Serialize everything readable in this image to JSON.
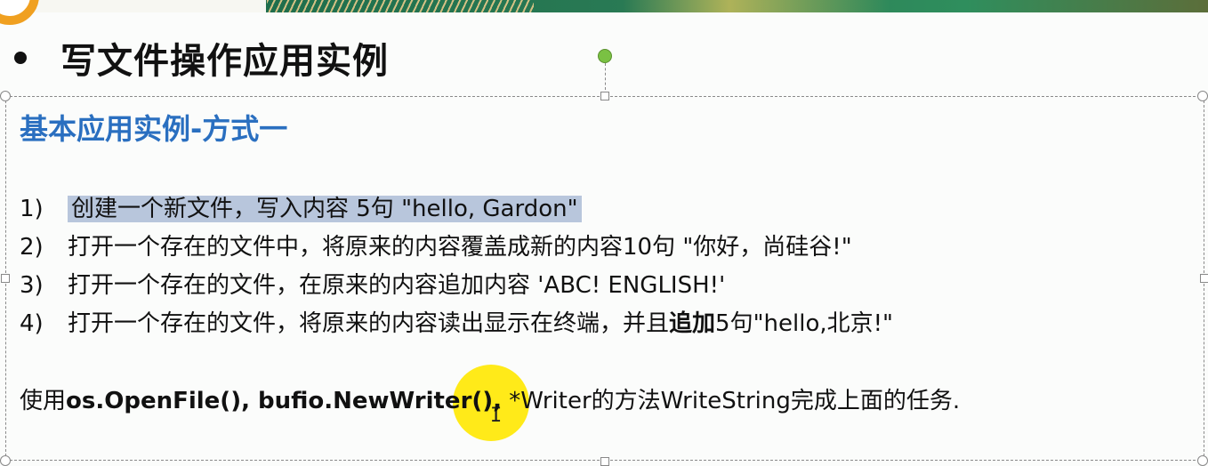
{
  "heading": "写文件操作应用实例",
  "subtitle": "基本应用实例-方式一",
  "tasks": [
    {
      "num": "1)",
      "text": "创建一个新文件，写入内容 5句 \"hello, Gardon\""
    },
    {
      "num": "2)",
      "text": "打开一个存在的文件中，将原来的内容覆盖成新的内容10句 \"你好，尚硅谷!\""
    },
    {
      "num": "3)",
      "text": "打开一个存在的文件，在原来的内容追加内容 'ABC! ENGLISH!'"
    },
    {
      "num": "4)",
      "text_before": "打开一个存在的文件，将原来的内容读出显示在终端，并且",
      "text_bold": "追加",
      "text_after": "5句\"hello,北京!\""
    }
  ],
  "footer": {
    "prefix": "使用",
    "bold_part": "os.OpenFile(), bufio.NewWriter(),",
    "suffix": " *Writer的方法WriteString完成上面的任务."
  },
  "colors": {
    "subtitle": "#2a6fc0",
    "selection_highlight": "#b8c6dc",
    "cursor_highlight": "#ffe800",
    "rotation_handle": "#7ac143"
  },
  "icons": {
    "bullet": "bullet-dot",
    "rotation_handle": "rotation-handle-icon",
    "cursor": "text-cursor-icon"
  }
}
